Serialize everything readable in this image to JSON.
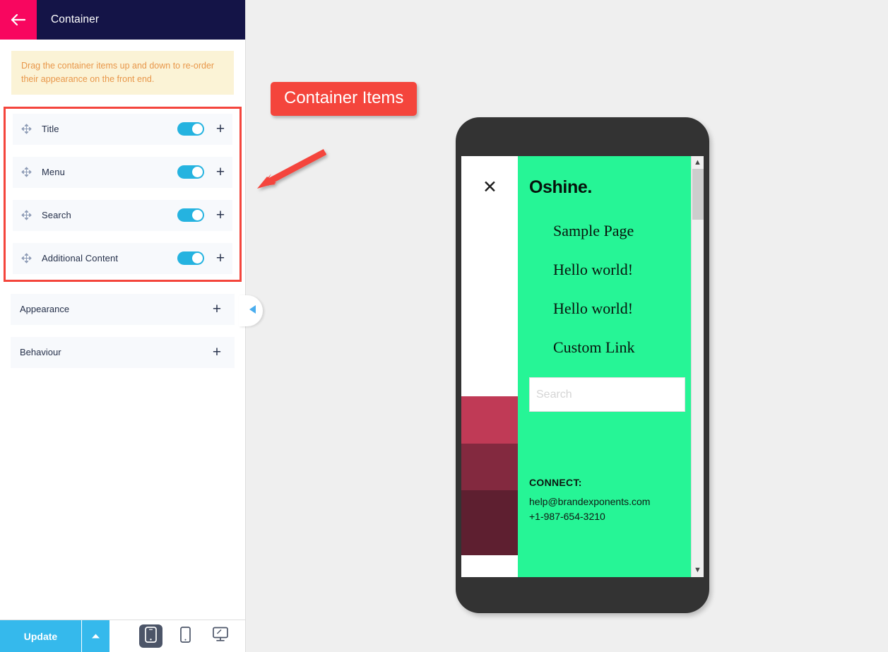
{
  "panel": {
    "header": {
      "title": "Container",
      "back_icon": "arrow-left-icon"
    },
    "notice": "Drag the container items up and down to re-order their appearance on the front end.",
    "items": [
      {
        "label": "Title",
        "toggle": "on",
        "expand_icon": "plus-icon",
        "handle_icon": "move-icon"
      },
      {
        "label": "Menu",
        "toggle": "on",
        "expand_icon": "plus-icon",
        "handle_icon": "move-icon"
      },
      {
        "label": "Search",
        "toggle": "on",
        "expand_icon": "plus-icon",
        "handle_icon": "move-icon"
      },
      {
        "label": "Additional Content",
        "toggle": "on",
        "expand_icon": "plus-icon",
        "handle_icon": "move-icon"
      }
    ],
    "sections": [
      {
        "label": "Appearance",
        "expand_icon": "plus-icon"
      },
      {
        "label": "Behaviour",
        "expand_icon": "plus-icon"
      }
    ],
    "collapse_icon": "chevron-left-icon",
    "footer": {
      "update_label": "Update",
      "caret_icon": "chevron-up-icon",
      "devices": [
        {
          "name": "mobile",
          "icon": "mobile-icon",
          "active": true
        },
        {
          "name": "tablet",
          "icon": "tablet-icon",
          "active": false
        },
        {
          "name": "desktop",
          "icon": "desktop-icon",
          "active": false
        }
      ]
    }
  },
  "annotation": {
    "label": "Container Items",
    "color": "#f4453c"
  },
  "preview": {
    "close_icon": "close-x-icon",
    "brand": "Oshine.",
    "menu": [
      "Sample Page",
      "Hello world!",
      "Hello world!",
      "Custom Link"
    ],
    "search_placeholder": "Search",
    "connect_title": "CONNECT:",
    "connect_lines": [
      "help@brandexponents.com",
      "+1-987-654-3210"
    ],
    "scrollbar": {
      "up_icon": "chevron-up-icon",
      "down_icon": "chevron-down-icon"
    },
    "accent_color": "#26f596",
    "swatches": [
      "#ffffff",
      "#c03a56",
      "#83293f",
      "#5e1f30",
      "#ffffff"
    ]
  }
}
